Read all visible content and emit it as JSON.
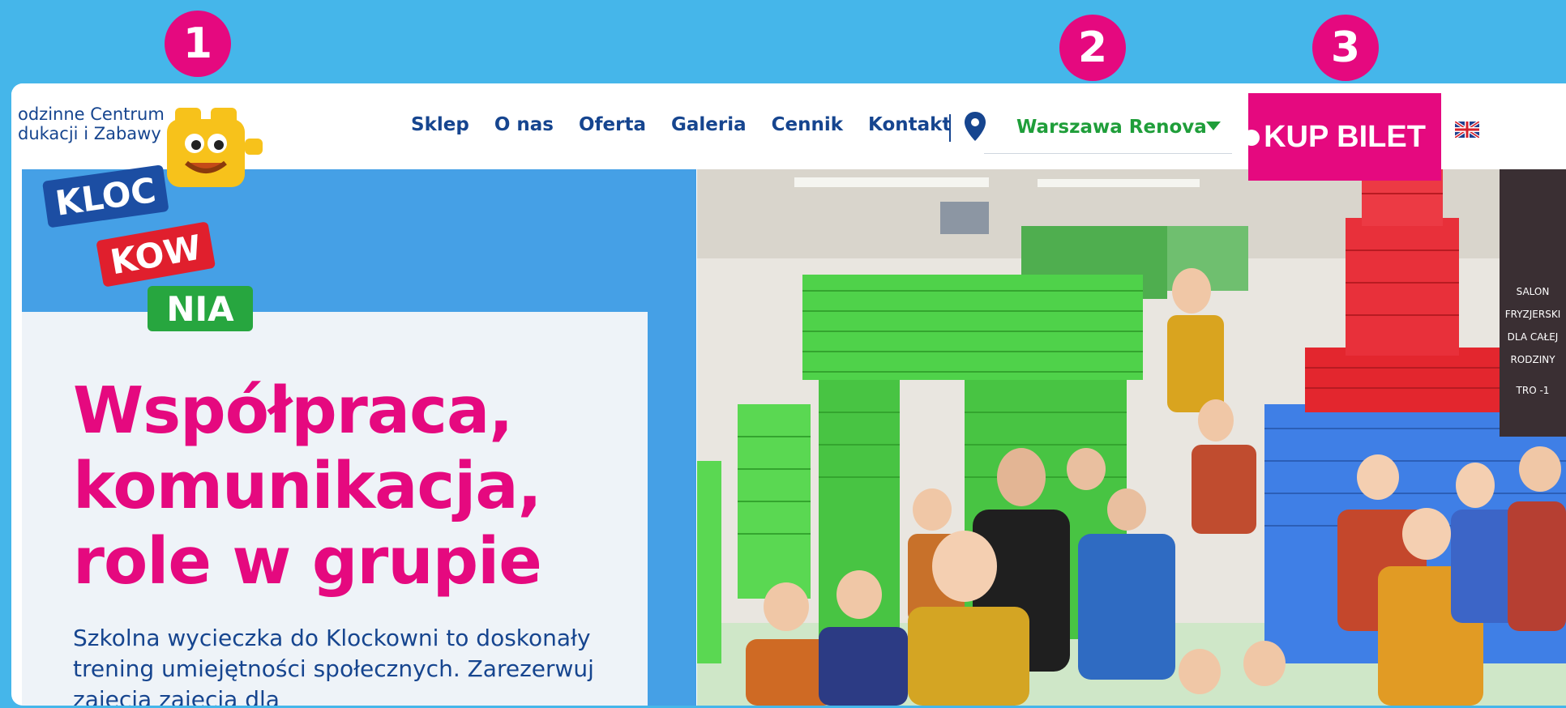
{
  "markers": [
    "1",
    "2",
    "3"
  ],
  "logo": {
    "tagline_line1": "odzinne Centrum",
    "tagline_line2": "dukacji i Zabawy",
    "word1": "KLOC",
    "word2": "KOW",
    "word3": "NIA"
  },
  "nav": {
    "items": [
      "Sklep",
      "O nas",
      "Oferta",
      "Galeria",
      "Cennik",
      "Kontakt"
    ]
  },
  "location": {
    "icon": "map-pin-icon",
    "selected": "Warszawa Renova"
  },
  "cta": {
    "label": "KUP BILET"
  },
  "language": {
    "icon": "uk-flag-icon"
  },
  "hero": {
    "heading_line1": "Współpraca,",
    "heading_line2": "komunikacja,",
    "heading_line3": "role w grupie",
    "description": "Szkolna wycieczka do Klockowni to doskonały trening umiejętności społecznych. Zarezerwuj zajęcia zajęcia dla"
  },
  "photo_sign": [
    "SALON",
    "FRYZJERSKI",
    "DLA CAŁEJ",
    "RODZINY",
    "TRO -1"
  ],
  "colors": {
    "background": "#45b6ea",
    "brand_pink": "#e5097f",
    "brand_navy": "#16458f",
    "brand_green": "#1f9e3a",
    "panel_blue": "#45a0e6"
  }
}
